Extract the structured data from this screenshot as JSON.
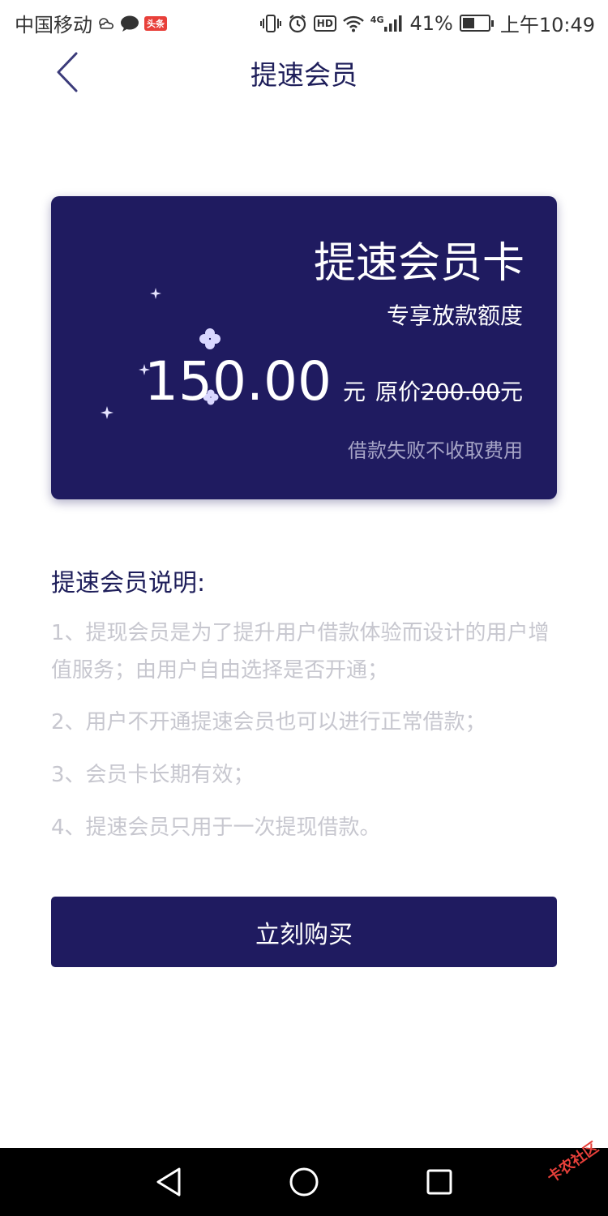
{
  "status": {
    "carrier": "中国移动",
    "news_badge": "头条",
    "network": "4G",
    "battery_percent": "41%",
    "battery_level": 0.41,
    "time": "上午10:49",
    "hd": "HD"
  },
  "header": {
    "title": "提速会员"
  },
  "card": {
    "title": "提速会员卡",
    "subtitle": "专享放款额度",
    "price": "150.00",
    "price_unit": "元",
    "original_label": "原价",
    "original_value": "200.00",
    "original_unit": "元",
    "note": "借款失败不收取费用"
  },
  "description": {
    "title": "提速会员说明:",
    "items": [
      "1、提现会员是为了提升用户借款体验而设计的用户增值服务；由用户自由选择是否开通；",
      "2、用户不开通提速会员也可以进行正常借款；",
      "3、会员卡长期有效；",
      "4、提速会员只用于一次提现借款。"
    ]
  },
  "buy_button": {
    "label": "立刻购买"
  },
  "watermark": "卡农社区",
  "colors": {
    "primary": "#1f1b60",
    "title_text": "#1e1e5a",
    "muted_text": "#c7c7cf",
    "card_note": "#a6a4c6"
  }
}
